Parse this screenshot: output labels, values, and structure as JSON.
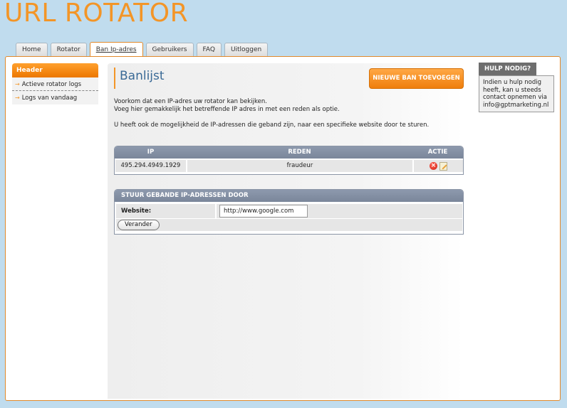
{
  "app": {
    "title": "URL ROTATOR"
  },
  "tabs": [
    {
      "label": "Home"
    },
    {
      "label": "Rotator"
    },
    {
      "label": "Ban Ip-adres",
      "active": true
    },
    {
      "label": "Gebruikers"
    },
    {
      "label": "FAQ"
    },
    {
      "label": "Uitloggen"
    }
  ],
  "sidebar": {
    "header": "Header",
    "items": [
      {
        "label": "Actieve rotator logs"
      },
      {
        "label": "Logs van vandaag"
      }
    ]
  },
  "page": {
    "title": "Banlijst",
    "new_ban_button": "NIEUWE BAN TOEVOEGEN",
    "intro_line1": "Voorkom dat een IP-adres uw rotator kan bekijken.",
    "intro_line2": "Voeg hier gemakkelijk het betreffende IP adres in met een reden als optie.",
    "intro_line3": "U heeft ook de mogelijkheid de IP-adressen die geband zijn, naar een specifieke website door te sturen."
  },
  "ban_table": {
    "headers": {
      "ip": "IP",
      "reason": "REDEN",
      "action": "ACTIE"
    },
    "rows": [
      {
        "ip": "495.294.4949.1929",
        "reason": "fraudeur"
      }
    ]
  },
  "redirect": {
    "title": "STUUR GEBANDE IP-ADRESSEN DOOR",
    "website_label": "Website:",
    "website_value": "http://www.google.com",
    "change_button": "Verander"
  },
  "help": {
    "title": "HULP NODIG?",
    "line1": "Indien u hulp nodig",
    "line2": "heeft, kan u steeds",
    "line3": "contact opnemen via",
    "line4": "info@gptmarketing.nl"
  },
  "colors": {
    "brand_orange": "#f39527",
    "page_background": "#c0dcee",
    "panel_header": "#7f8b9f"
  },
  "icons": {
    "row_delete": "delete-icon",
    "row_edit": "edit-icon",
    "menu_bullet": "arrow-right-icon"
  }
}
